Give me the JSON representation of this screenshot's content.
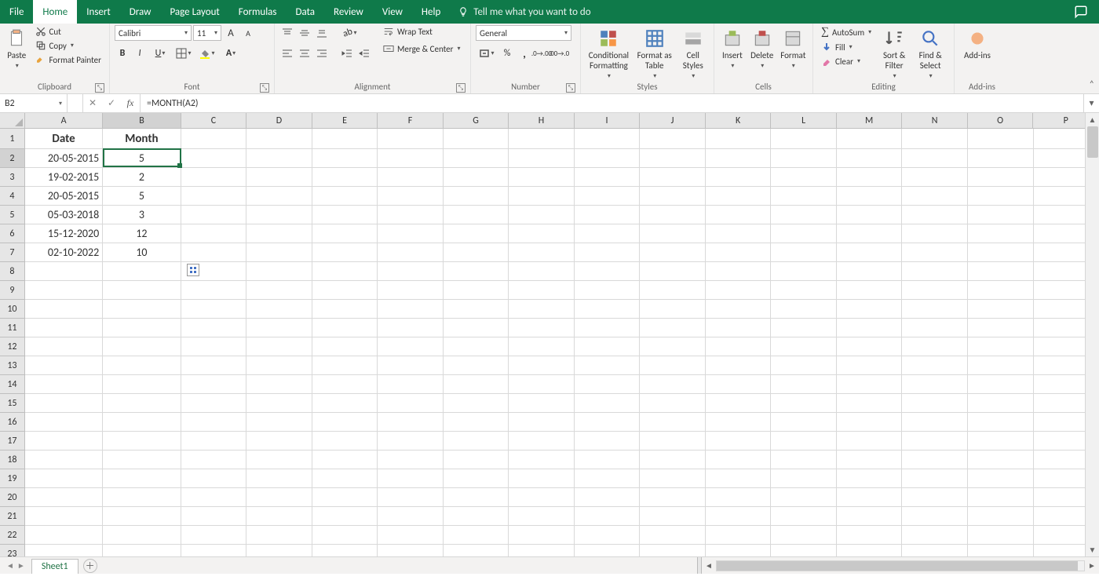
{
  "tabs": {
    "file": "File",
    "home": "Home",
    "insert": "Insert",
    "draw": "Draw",
    "pagelayout": "Page Layout",
    "formulas": "Formulas",
    "data": "Data",
    "review": "Review",
    "view": "View",
    "help": "Help",
    "tellme": "Tell me what you want to do"
  },
  "ribbon": {
    "clipboard": {
      "paste": "Paste",
      "cut": "Cut",
      "copy": "Copy",
      "formatpainter": "Format Painter",
      "label": "Clipboard"
    },
    "font": {
      "name": "Calibri",
      "size": "11",
      "label": "Font"
    },
    "alignment": {
      "wrap": "Wrap Text",
      "merge": "Merge & Center",
      "label": "Alignment"
    },
    "number": {
      "format": "General",
      "label": "Number"
    },
    "styles": {
      "cond": "Conditional Formatting",
      "table": "Format as Table",
      "cell": "Cell Styles",
      "label": "Styles"
    },
    "cells": {
      "insert": "Insert",
      "delete": "Delete",
      "format": "Format",
      "label": "Cells"
    },
    "editing": {
      "sum": "AutoSum",
      "fill": "Fill",
      "clear": "Clear",
      "sort": "Sort & Filter",
      "find": "Find & Select",
      "label": "Editing"
    },
    "addins": {
      "label": "Add-ins",
      "btn": "Add-ins"
    }
  },
  "namebox": "B2",
  "formula": "=MONTH(A2)",
  "columns": [
    "A",
    "B",
    "C",
    "D",
    "E",
    "F",
    "G",
    "H",
    "I",
    "J",
    "K",
    "L",
    "M",
    "N",
    "O",
    "P"
  ],
  "rownums": [
    "1",
    "2",
    "3",
    "4",
    "5",
    "6",
    "7",
    "8",
    "9",
    "10",
    "11",
    "12",
    "13",
    "14",
    "15",
    "16",
    "17",
    "18",
    "19",
    "20",
    "21",
    "22",
    "23"
  ],
  "header": {
    "A": "Date",
    "B": "Month"
  },
  "data": [
    {
      "A": "20-05-2015",
      "B": "5"
    },
    {
      "A": "19-02-2015",
      "B": "2"
    },
    {
      "A": "20-05-2015",
      "B": "5"
    },
    {
      "A": "05-03-2018",
      "B": "3"
    },
    {
      "A": "15-12-2020",
      "B": "12"
    },
    {
      "A": "02-10-2022",
      "B": "10"
    }
  ],
  "sheet": "Sheet1"
}
